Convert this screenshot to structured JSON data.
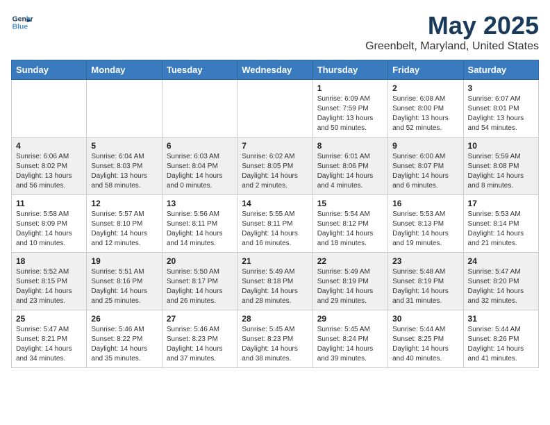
{
  "logo": {
    "line1": "General",
    "line2": "Blue"
  },
  "title": "May 2025",
  "location": "Greenbelt, Maryland, United States",
  "days_of_week": [
    "Sunday",
    "Monday",
    "Tuesday",
    "Wednesday",
    "Thursday",
    "Friday",
    "Saturday"
  ],
  "weeks": [
    [
      {
        "day": "",
        "info": ""
      },
      {
        "day": "",
        "info": ""
      },
      {
        "day": "",
        "info": ""
      },
      {
        "day": "",
        "info": ""
      },
      {
        "day": "1",
        "info": "Sunrise: 6:09 AM\nSunset: 7:59 PM\nDaylight: 13 hours\nand 50 minutes."
      },
      {
        "day": "2",
        "info": "Sunrise: 6:08 AM\nSunset: 8:00 PM\nDaylight: 13 hours\nand 52 minutes."
      },
      {
        "day": "3",
        "info": "Sunrise: 6:07 AM\nSunset: 8:01 PM\nDaylight: 13 hours\nand 54 minutes."
      }
    ],
    [
      {
        "day": "4",
        "info": "Sunrise: 6:06 AM\nSunset: 8:02 PM\nDaylight: 13 hours\nand 56 minutes."
      },
      {
        "day": "5",
        "info": "Sunrise: 6:04 AM\nSunset: 8:03 PM\nDaylight: 13 hours\nand 58 minutes."
      },
      {
        "day": "6",
        "info": "Sunrise: 6:03 AM\nSunset: 8:04 PM\nDaylight: 14 hours\nand 0 minutes."
      },
      {
        "day": "7",
        "info": "Sunrise: 6:02 AM\nSunset: 8:05 PM\nDaylight: 14 hours\nand 2 minutes."
      },
      {
        "day": "8",
        "info": "Sunrise: 6:01 AM\nSunset: 8:06 PM\nDaylight: 14 hours\nand 4 minutes."
      },
      {
        "day": "9",
        "info": "Sunrise: 6:00 AM\nSunset: 8:07 PM\nDaylight: 14 hours\nand 6 minutes."
      },
      {
        "day": "10",
        "info": "Sunrise: 5:59 AM\nSunset: 8:08 PM\nDaylight: 14 hours\nand 8 minutes."
      }
    ],
    [
      {
        "day": "11",
        "info": "Sunrise: 5:58 AM\nSunset: 8:09 PM\nDaylight: 14 hours\nand 10 minutes."
      },
      {
        "day": "12",
        "info": "Sunrise: 5:57 AM\nSunset: 8:10 PM\nDaylight: 14 hours\nand 12 minutes."
      },
      {
        "day": "13",
        "info": "Sunrise: 5:56 AM\nSunset: 8:11 PM\nDaylight: 14 hours\nand 14 minutes."
      },
      {
        "day": "14",
        "info": "Sunrise: 5:55 AM\nSunset: 8:11 PM\nDaylight: 14 hours\nand 16 minutes."
      },
      {
        "day": "15",
        "info": "Sunrise: 5:54 AM\nSunset: 8:12 PM\nDaylight: 14 hours\nand 18 minutes."
      },
      {
        "day": "16",
        "info": "Sunrise: 5:53 AM\nSunset: 8:13 PM\nDaylight: 14 hours\nand 19 minutes."
      },
      {
        "day": "17",
        "info": "Sunrise: 5:53 AM\nSunset: 8:14 PM\nDaylight: 14 hours\nand 21 minutes."
      }
    ],
    [
      {
        "day": "18",
        "info": "Sunrise: 5:52 AM\nSunset: 8:15 PM\nDaylight: 14 hours\nand 23 minutes."
      },
      {
        "day": "19",
        "info": "Sunrise: 5:51 AM\nSunset: 8:16 PM\nDaylight: 14 hours\nand 25 minutes."
      },
      {
        "day": "20",
        "info": "Sunrise: 5:50 AM\nSunset: 8:17 PM\nDaylight: 14 hours\nand 26 minutes."
      },
      {
        "day": "21",
        "info": "Sunrise: 5:49 AM\nSunset: 8:18 PM\nDaylight: 14 hours\nand 28 minutes."
      },
      {
        "day": "22",
        "info": "Sunrise: 5:49 AM\nSunset: 8:19 PM\nDaylight: 14 hours\nand 29 minutes."
      },
      {
        "day": "23",
        "info": "Sunrise: 5:48 AM\nSunset: 8:19 PM\nDaylight: 14 hours\nand 31 minutes."
      },
      {
        "day": "24",
        "info": "Sunrise: 5:47 AM\nSunset: 8:20 PM\nDaylight: 14 hours\nand 32 minutes."
      }
    ],
    [
      {
        "day": "25",
        "info": "Sunrise: 5:47 AM\nSunset: 8:21 PM\nDaylight: 14 hours\nand 34 minutes."
      },
      {
        "day": "26",
        "info": "Sunrise: 5:46 AM\nSunset: 8:22 PM\nDaylight: 14 hours\nand 35 minutes."
      },
      {
        "day": "27",
        "info": "Sunrise: 5:46 AM\nSunset: 8:23 PM\nDaylight: 14 hours\nand 37 minutes."
      },
      {
        "day": "28",
        "info": "Sunrise: 5:45 AM\nSunset: 8:23 PM\nDaylight: 14 hours\nand 38 minutes."
      },
      {
        "day": "29",
        "info": "Sunrise: 5:45 AM\nSunset: 8:24 PM\nDaylight: 14 hours\nand 39 minutes."
      },
      {
        "day": "30",
        "info": "Sunrise: 5:44 AM\nSunset: 8:25 PM\nDaylight: 14 hours\nand 40 minutes."
      },
      {
        "day": "31",
        "info": "Sunrise: 5:44 AM\nSunset: 8:26 PM\nDaylight: 14 hours\nand 41 minutes."
      }
    ]
  ]
}
